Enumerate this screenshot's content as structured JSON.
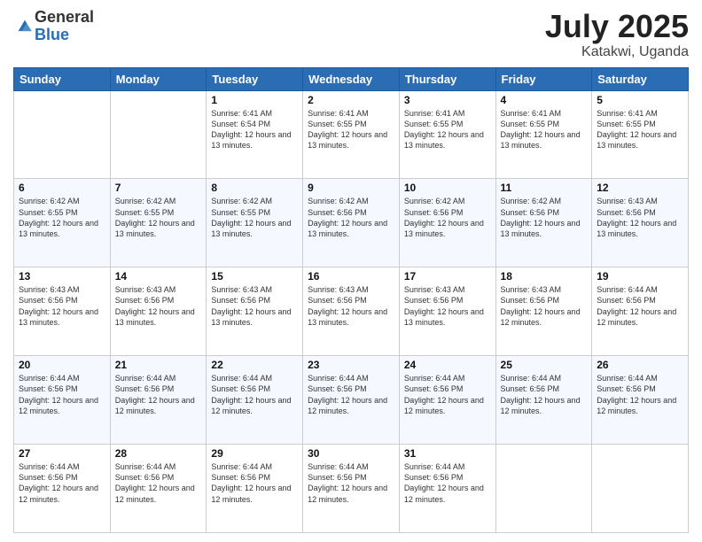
{
  "logo": {
    "general": "General",
    "blue": "Blue"
  },
  "title": {
    "month": "July 2025",
    "location": "Katakwi, Uganda"
  },
  "headers": [
    "Sunday",
    "Monday",
    "Tuesday",
    "Wednesday",
    "Thursday",
    "Friday",
    "Saturday"
  ],
  "weeks": [
    [
      {
        "day": "",
        "info": ""
      },
      {
        "day": "",
        "info": ""
      },
      {
        "day": "1",
        "info": "Sunrise: 6:41 AM\nSunset: 6:54 PM\nDaylight: 12 hours and 13 minutes."
      },
      {
        "day": "2",
        "info": "Sunrise: 6:41 AM\nSunset: 6:55 PM\nDaylight: 12 hours and 13 minutes."
      },
      {
        "day": "3",
        "info": "Sunrise: 6:41 AM\nSunset: 6:55 PM\nDaylight: 12 hours and 13 minutes."
      },
      {
        "day": "4",
        "info": "Sunrise: 6:41 AM\nSunset: 6:55 PM\nDaylight: 12 hours and 13 minutes."
      },
      {
        "day": "5",
        "info": "Sunrise: 6:41 AM\nSunset: 6:55 PM\nDaylight: 12 hours and 13 minutes."
      }
    ],
    [
      {
        "day": "6",
        "info": "Sunrise: 6:42 AM\nSunset: 6:55 PM\nDaylight: 12 hours and 13 minutes."
      },
      {
        "day": "7",
        "info": "Sunrise: 6:42 AM\nSunset: 6:55 PM\nDaylight: 12 hours and 13 minutes."
      },
      {
        "day": "8",
        "info": "Sunrise: 6:42 AM\nSunset: 6:55 PM\nDaylight: 12 hours and 13 minutes."
      },
      {
        "day": "9",
        "info": "Sunrise: 6:42 AM\nSunset: 6:56 PM\nDaylight: 12 hours and 13 minutes."
      },
      {
        "day": "10",
        "info": "Sunrise: 6:42 AM\nSunset: 6:56 PM\nDaylight: 12 hours and 13 minutes."
      },
      {
        "day": "11",
        "info": "Sunrise: 6:42 AM\nSunset: 6:56 PM\nDaylight: 12 hours and 13 minutes."
      },
      {
        "day": "12",
        "info": "Sunrise: 6:43 AM\nSunset: 6:56 PM\nDaylight: 12 hours and 13 minutes."
      }
    ],
    [
      {
        "day": "13",
        "info": "Sunrise: 6:43 AM\nSunset: 6:56 PM\nDaylight: 12 hours and 13 minutes."
      },
      {
        "day": "14",
        "info": "Sunrise: 6:43 AM\nSunset: 6:56 PM\nDaylight: 12 hours and 13 minutes."
      },
      {
        "day": "15",
        "info": "Sunrise: 6:43 AM\nSunset: 6:56 PM\nDaylight: 12 hours and 13 minutes."
      },
      {
        "day": "16",
        "info": "Sunrise: 6:43 AM\nSunset: 6:56 PM\nDaylight: 12 hours and 13 minutes."
      },
      {
        "day": "17",
        "info": "Sunrise: 6:43 AM\nSunset: 6:56 PM\nDaylight: 12 hours and 13 minutes."
      },
      {
        "day": "18",
        "info": "Sunrise: 6:43 AM\nSunset: 6:56 PM\nDaylight: 12 hours and 12 minutes."
      },
      {
        "day": "19",
        "info": "Sunrise: 6:44 AM\nSunset: 6:56 PM\nDaylight: 12 hours and 12 minutes."
      }
    ],
    [
      {
        "day": "20",
        "info": "Sunrise: 6:44 AM\nSunset: 6:56 PM\nDaylight: 12 hours and 12 minutes."
      },
      {
        "day": "21",
        "info": "Sunrise: 6:44 AM\nSunset: 6:56 PM\nDaylight: 12 hours and 12 minutes."
      },
      {
        "day": "22",
        "info": "Sunrise: 6:44 AM\nSunset: 6:56 PM\nDaylight: 12 hours and 12 minutes."
      },
      {
        "day": "23",
        "info": "Sunrise: 6:44 AM\nSunset: 6:56 PM\nDaylight: 12 hours and 12 minutes."
      },
      {
        "day": "24",
        "info": "Sunrise: 6:44 AM\nSunset: 6:56 PM\nDaylight: 12 hours and 12 minutes."
      },
      {
        "day": "25",
        "info": "Sunrise: 6:44 AM\nSunset: 6:56 PM\nDaylight: 12 hours and 12 minutes."
      },
      {
        "day": "26",
        "info": "Sunrise: 6:44 AM\nSunset: 6:56 PM\nDaylight: 12 hours and 12 minutes."
      }
    ],
    [
      {
        "day": "27",
        "info": "Sunrise: 6:44 AM\nSunset: 6:56 PM\nDaylight: 12 hours and 12 minutes."
      },
      {
        "day": "28",
        "info": "Sunrise: 6:44 AM\nSunset: 6:56 PM\nDaylight: 12 hours and 12 minutes."
      },
      {
        "day": "29",
        "info": "Sunrise: 6:44 AM\nSunset: 6:56 PM\nDaylight: 12 hours and 12 minutes."
      },
      {
        "day": "30",
        "info": "Sunrise: 6:44 AM\nSunset: 6:56 PM\nDaylight: 12 hours and 12 minutes."
      },
      {
        "day": "31",
        "info": "Sunrise: 6:44 AM\nSunset: 6:56 PM\nDaylight: 12 hours and 12 minutes."
      },
      {
        "day": "",
        "info": ""
      },
      {
        "day": "",
        "info": ""
      }
    ]
  ]
}
